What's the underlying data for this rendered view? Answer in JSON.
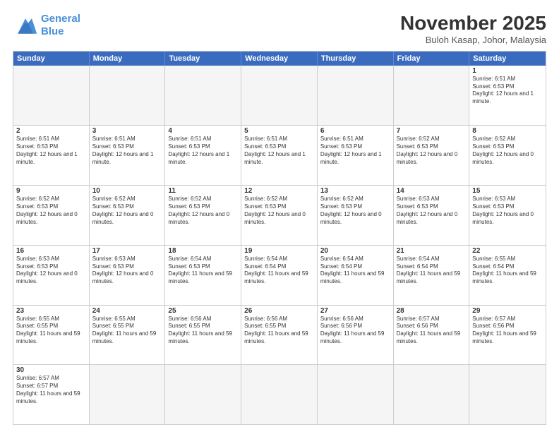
{
  "header": {
    "logo_general": "General",
    "logo_blue": "Blue",
    "title": "November 2025",
    "subtitle": "Buloh Kasap, Johor, Malaysia"
  },
  "days": [
    "Sunday",
    "Monday",
    "Tuesday",
    "Wednesday",
    "Thursday",
    "Friday",
    "Saturday"
  ],
  "weeks": [
    [
      {
        "day": "",
        "info": "",
        "empty": true
      },
      {
        "day": "",
        "info": "",
        "empty": true
      },
      {
        "day": "",
        "info": "",
        "empty": true
      },
      {
        "day": "",
        "info": "",
        "empty": true
      },
      {
        "day": "",
        "info": "",
        "empty": true
      },
      {
        "day": "",
        "info": "",
        "empty": true
      },
      {
        "day": "1",
        "info": "Sunrise: 6:51 AM\nSunset: 6:53 PM\nDaylight: 12 hours and 1 minute.",
        "empty": false
      }
    ],
    [
      {
        "day": "2",
        "info": "Sunrise: 6:51 AM\nSunset: 6:53 PM\nDaylight: 12 hours and 1 minute.",
        "empty": false
      },
      {
        "day": "3",
        "info": "Sunrise: 6:51 AM\nSunset: 6:53 PM\nDaylight: 12 hours and 1 minute.",
        "empty": false
      },
      {
        "day": "4",
        "info": "Sunrise: 6:51 AM\nSunset: 6:53 PM\nDaylight: 12 hours and 1 minute.",
        "empty": false
      },
      {
        "day": "5",
        "info": "Sunrise: 6:51 AM\nSunset: 6:53 PM\nDaylight: 12 hours and 1 minute.",
        "empty": false
      },
      {
        "day": "6",
        "info": "Sunrise: 6:51 AM\nSunset: 6:53 PM\nDaylight: 12 hours and 1 minute.",
        "empty": false
      },
      {
        "day": "7",
        "info": "Sunrise: 6:52 AM\nSunset: 6:53 PM\nDaylight: 12 hours and 0 minutes.",
        "empty": false
      },
      {
        "day": "8",
        "info": "Sunrise: 6:52 AM\nSunset: 6:53 PM\nDaylight: 12 hours and 0 minutes.",
        "empty": false
      }
    ],
    [
      {
        "day": "9",
        "info": "Sunrise: 6:52 AM\nSunset: 6:53 PM\nDaylight: 12 hours and 0 minutes.",
        "empty": false
      },
      {
        "day": "10",
        "info": "Sunrise: 6:52 AM\nSunset: 6:53 PM\nDaylight: 12 hours and 0 minutes.",
        "empty": false
      },
      {
        "day": "11",
        "info": "Sunrise: 6:52 AM\nSunset: 6:53 PM\nDaylight: 12 hours and 0 minutes.",
        "empty": false
      },
      {
        "day": "12",
        "info": "Sunrise: 6:52 AM\nSunset: 6:53 PM\nDaylight: 12 hours and 0 minutes.",
        "empty": false
      },
      {
        "day": "13",
        "info": "Sunrise: 6:52 AM\nSunset: 6:53 PM\nDaylight: 12 hours and 0 minutes.",
        "empty": false
      },
      {
        "day": "14",
        "info": "Sunrise: 6:53 AM\nSunset: 6:53 PM\nDaylight: 12 hours and 0 minutes.",
        "empty": false
      },
      {
        "day": "15",
        "info": "Sunrise: 6:53 AM\nSunset: 6:53 PM\nDaylight: 12 hours and 0 minutes.",
        "empty": false
      }
    ],
    [
      {
        "day": "16",
        "info": "Sunrise: 6:53 AM\nSunset: 6:53 PM\nDaylight: 12 hours and 0 minutes.",
        "empty": false
      },
      {
        "day": "17",
        "info": "Sunrise: 6:53 AM\nSunset: 6:53 PM\nDaylight: 12 hours and 0 minutes.",
        "empty": false
      },
      {
        "day": "18",
        "info": "Sunrise: 6:54 AM\nSunset: 6:53 PM\nDaylight: 11 hours and 59 minutes.",
        "empty": false
      },
      {
        "day": "19",
        "info": "Sunrise: 6:54 AM\nSunset: 6:54 PM\nDaylight: 11 hours and 59 minutes.",
        "empty": false
      },
      {
        "day": "20",
        "info": "Sunrise: 6:54 AM\nSunset: 6:54 PM\nDaylight: 11 hours and 59 minutes.",
        "empty": false
      },
      {
        "day": "21",
        "info": "Sunrise: 6:54 AM\nSunset: 6:54 PM\nDaylight: 11 hours and 59 minutes.",
        "empty": false
      },
      {
        "day": "22",
        "info": "Sunrise: 6:55 AM\nSunset: 6:54 PM\nDaylight: 11 hours and 59 minutes.",
        "empty": false
      }
    ],
    [
      {
        "day": "23",
        "info": "Sunrise: 6:55 AM\nSunset: 6:55 PM\nDaylight: 11 hours and 59 minutes.",
        "empty": false
      },
      {
        "day": "24",
        "info": "Sunrise: 6:55 AM\nSunset: 6:55 PM\nDaylight: 11 hours and 59 minutes.",
        "empty": false
      },
      {
        "day": "25",
        "info": "Sunrise: 6:56 AM\nSunset: 6:55 PM\nDaylight: 11 hours and 59 minutes.",
        "empty": false
      },
      {
        "day": "26",
        "info": "Sunrise: 6:56 AM\nSunset: 6:55 PM\nDaylight: 11 hours and 59 minutes.",
        "empty": false
      },
      {
        "day": "27",
        "info": "Sunrise: 6:56 AM\nSunset: 6:56 PM\nDaylight: 11 hours and 59 minutes.",
        "empty": false
      },
      {
        "day": "28",
        "info": "Sunrise: 6:57 AM\nSunset: 6:56 PM\nDaylight: 11 hours and 59 minutes.",
        "empty": false
      },
      {
        "day": "29",
        "info": "Sunrise: 6:57 AM\nSunset: 6:56 PM\nDaylight: 11 hours and 59 minutes.",
        "empty": false
      }
    ],
    [
      {
        "day": "30",
        "info": "Sunrise: 6:57 AM\nSunset: 6:57 PM\nDaylight: 11 hours and 59 minutes.",
        "empty": false
      },
      {
        "day": "",
        "info": "",
        "empty": true
      },
      {
        "day": "",
        "info": "",
        "empty": true
      },
      {
        "day": "",
        "info": "",
        "empty": true
      },
      {
        "day": "",
        "info": "",
        "empty": true
      },
      {
        "day": "",
        "info": "",
        "empty": true
      },
      {
        "day": "",
        "info": "",
        "empty": true
      }
    ]
  ]
}
